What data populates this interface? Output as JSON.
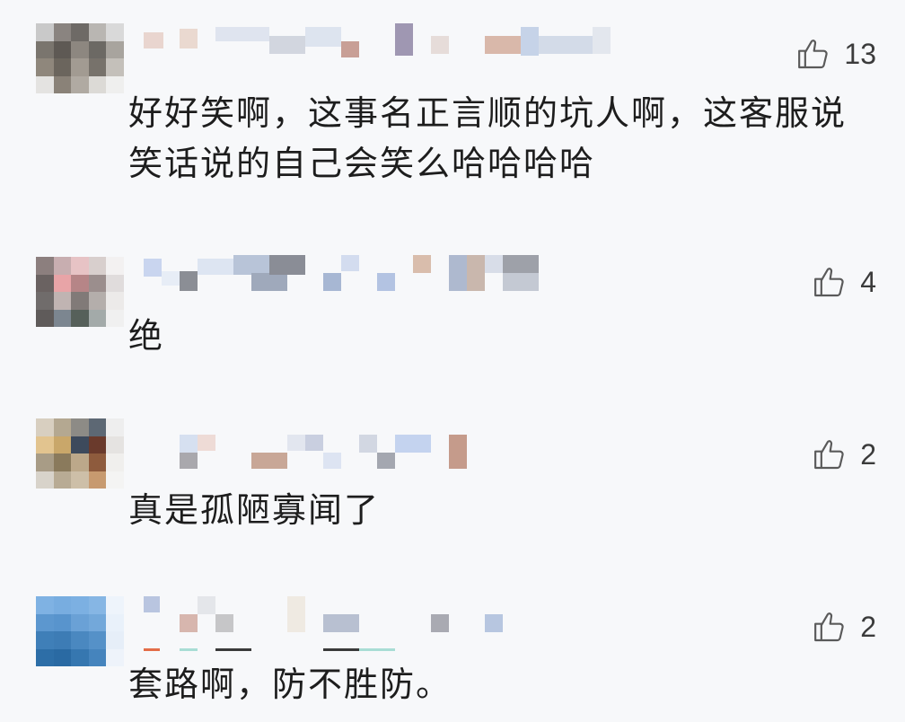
{
  "comments": [
    {
      "text": "好好笑啊，这事名正言顺的坑人啊，这客服说\n笑话说的自己会笑么哈哈哈哈",
      "likes": "13"
    },
    {
      "text": "绝",
      "likes": "4"
    },
    {
      "text": "真是孤陋寡闻了",
      "likes": "2"
    },
    {
      "text": "套路啊，防不胜防。",
      "likes": "2"
    }
  ],
  "icons": {
    "like": "thumbs-up-icon"
  },
  "colors": {
    "background": "#f7f8fa",
    "text": "#1d1d1d",
    "like_icon": "#5a5a5a"
  }
}
